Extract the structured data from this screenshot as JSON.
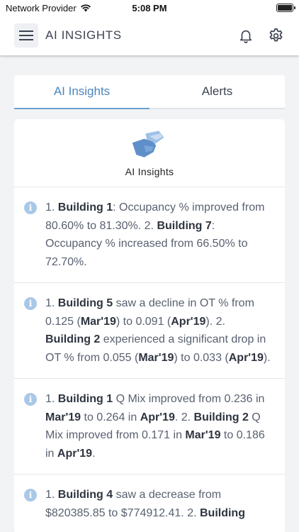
{
  "status": {
    "carrier": "Network Provider",
    "time": "5:08 PM"
  },
  "header": {
    "title": "AI INSIGHTS"
  },
  "tabs": [
    {
      "label": "AI Insights",
      "active": true
    },
    {
      "label": "Alerts",
      "active": false
    }
  ],
  "panel": {
    "title": "AI Insights"
  },
  "insights": [
    [
      {
        "t": "1. "
      },
      {
        "t": "Building 1",
        "b": true
      },
      {
        "t": ": Occupancy % improved from 80.60% to 81.30%. 2. "
      },
      {
        "t": "Building 7",
        "b": true
      },
      {
        "t": ": Occupancy % increased from 66.50% to 72.70%."
      }
    ],
    [
      {
        "t": "1. "
      },
      {
        "t": "Building 5",
        "b": true
      },
      {
        "t": " saw a decline in OT % from 0.125 ("
      },
      {
        "t": "Mar'19",
        "b": true
      },
      {
        "t": ") to 0.091 ("
      },
      {
        "t": "Apr'19",
        "b": true
      },
      {
        "t": "). 2. "
      },
      {
        "t": "Building 2",
        "b": true
      },
      {
        "t": " experienced a significant drop in OT % from 0.055 ("
      },
      {
        "t": "Mar'19",
        "b": true
      },
      {
        "t": ") to 0.033 ("
      },
      {
        "t": "Apr'19",
        "b": true
      },
      {
        "t": ")."
      }
    ],
    [
      {
        "t": "1. "
      },
      {
        "t": "Building 1",
        "b": true
      },
      {
        "t": " Q Mix improved from 0.236 in "
      },
      {
        "t": "Mar'19",
        "b": true
      },
      {
        "t": " to 0.264 in "
      },
      {
        "t": "Apr'19",
        "b": true
      },
      {
        "t": ". 2. "
      },
      {
        "t": "Building 2",
        "b": true
      },
      {
        "t": " Q Mix improved from 0.171 in "
      },
      {
        "t": "Mar'19",
        "b": true
      },
      {
        "t": " to 0.186 in "
      },
      {
        "t": "Apr'19",
        "b": true
      },
      {
        "t": "."
      }
    ],
    [
      {
        "t": "1. "
      },
      {
        "t": "Building 4",
        "b": true
      },
      {
        "t": " saw a decrease from $820385.85 to $774912.41. 2. "
      },
      {
        "t": "Building",
        "b": true
      }
    ]
  ],
  "colors": {
    "accent": "#4c86bd",
    "info_icon": "#a9c8e8",
    "logo_dark": "#5f8fc9",
    "logo_light": "#9fc0e6"
  },
  "icons": [
    "wifi-icon",
    "battery-icon",
    "menu-icon",
    "bell-icon",
    "gear-icon",
    "handshake-icon",
    "info-icon"
  ]
}
